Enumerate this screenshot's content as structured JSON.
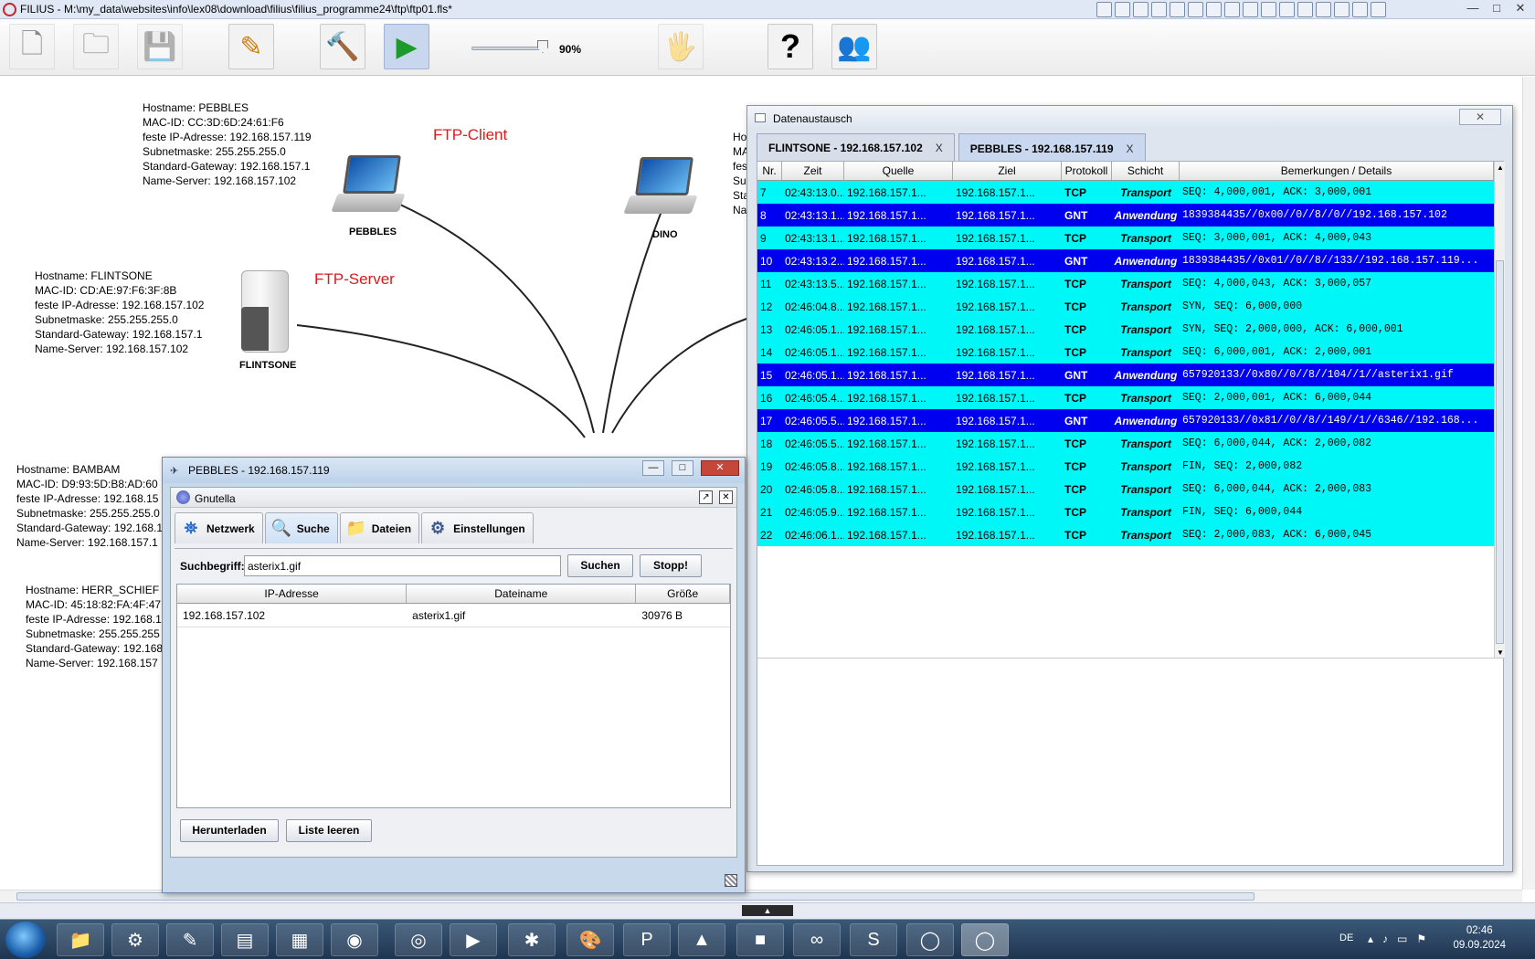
{
  "window": {
    "title": "FILIUS - M:\\my_data\\websites\\info\\lex08\\download\\filius\\filius_programme24\\ftp\\ftp01.fls*",
    "minimize": "—",
    "maximize": "□",
    "close": "✕"
  },
  "toolbar": {
    "zoom_label": "90%",
    "zoom_level": 0.9,
    "buttons": [
      {
        "icon": "new-file-icon",
        "glyph": "🗋"
      },
      {
        "icon": "open-folder-icon",
        "glyph": "🗀"
      },
      {
        "icon": "save-icon",
        "glyph": "💾"
      },
      {
        "icon": "pencil-icon",
        "glyph": "✎"
      },
      {
        "icon": "hammer-icon",
        "glyph": "🔨"
      },
      {
        "icon": "play-icon",
        "glyph": "▶"
      },
      {
        "icon": "documentation-icon",
        "glyph": "🖐"
      },
      {
        "icon": "help-icon",
        "glyph": "?"
      },
      {
        "icon": "info-icon",
        "glyph": "👥"
      }
    ]
  },
  "network": {
    "labels": {
      "ftp_client": "FTP-Client",
      "ftp_server": "FTP-Server"
    },
    "pebbles_info": [
      "Hostname: PEBBLES",
      "MAC-ID: CC:3D:6D:24:61:F6",
      "feste IP-Adresse: 192.168.157.119",
      "Subnetmaske: 255.255.255.0",
      "Standard-Gateway: 192.168.157.1",
      "Name-Server: 192.168.157.102"
    ],
    "flintsone_info": [
      "Hostname: FLINTSONE",
      "MAC-ID: CD:AE:97:F6:3F:8B",
      "feste IP-Adresse: 192.168.157.102",
      "Subnetmaske: 255.255.255.0",
      "Standard-Gateway: 192.168.157.1",
      "Name-Server: 192.168.157.102"
    ],
    "bambam_info": [
      "Hostname: BAMBAM",
      "MAC-ID: D9:93:5D:B8:AD:60",
      "feste IP-Adresse: 192.168.15",
      "Subnetmaske: 255.255.255.0",
      "Standard-Gateway: 192.168.1",
      "Name-Server: 192.168.157.1"
    ],
    "herr_info": [
      "Hostname: HERR_SCHIEF",
      "MAC-ID: 45:18:82:FA:4F:47",
      "feste IP-Adresse: 192.168.1",
      "Subnetmaske: 255.255.255",
      "Standard-Gateway: 192.168",
      "Name-Server: 192.168.157"
    ],
    "dino_partial": [
      "Ho",
      "MA",
      "fes",
      "Su",
      "Sta",
      "Na"
    ],
    "device_names": {
      "pebbles": "PEBBLES",
      "flintsone": "FLINTSONE",
      "dino": "DINO"
    }
  },
  "datenaustausch": {
    "title": "Datenaustausch",
    "tabs": [
      {
        "label": "FLINTSONE - 192.168.157.102",
        "close": "X"
      },
      {
        "label": "PEBBLES - 192.168.157.119",
        "close": "X"
      }
    ],
    "columns": [
      "Nr.",
      "Zeit",
      "Quelle",
      "Ziel",
      "Protokoll",
      "Schicht",
      "Bemerkungen / Details"
    ],
    "rows": [
      {
        "nr": "7",
        "zeit": "02:43:13.0...",
        "quelle": "192.168.157.1...",
        "ziel": "192.168.157.1...",
        "proto": "TCP",
        "schicht": "Transport",
        "det": "SEQ: 4,000,001, ACK: 3,000,001",
        "kind": "t"
      },
      {
        "nr": "8",
        "zeit": "02:43:13.1...",
        "quelle": "192.168.157.1...",
        "ziel": "192.168.157.1...",
        "proto": "GNT",
        "schicht": "Anwendung",
        "det": "1839384435//0x00//0//8//0//192.168.157.102",
        "kind": "a"
      },
      {
        "nr": "9",
        "zeit": "02:43:13.1...",
        "quelle": "192.168.157.1...",
        "ziel": "192.168.157.1...",
        "proto": "TCP",
        "schicht": "Transport",
        "det": "SEQ: 3,000,001, ACK: 4,000,043",
        "kind": "t"
      },
      {
        "nr": "10",
        "zeit": "02:43:13.2...",
        "quelle": "192.168.157.1...",
        "ziel": "192.168.157.1...",
        "proto": "GNT",
        "schicht": "Anwendung",
        "det": "1839384435//0x01//0//8//133//192.168.157.119...",
        "kind": "a"
      },
      {
        "nr": "11",
        "zeit": "02:43:13.5...",
        "quelle": "192.168.157.1...",
        "ziel": "192.168.157.1...",
        "proto": "TCP",
        "schicht": "Transport",
        "det": "SEQ: 4,000,043, ACK: 3,000,057",
        "kind": "t"
      },
      {
        "nr": "12",
        "zeit": "02:46:04.8...",
        "quelle": "192.168.157.1...",
        "ziel": "192.168.157.1...",
        "proto": "TCP",
        "schicht": "Transport",
        "det": "SYN, SEQ: 6,000,000",
        "kind": "t"
      },
      {
        "nr": "13",
        "zeit": "02:46:05.1...",
        "quelle": "192.168.157.1...",
        "ziel": "192.168.157.1...",
        "proto": "TCP",
        "schicht": "Transport",
        "det": "SYN, SEQ: 2,000,000, ACK: 6,000,001",
        "kind": "t"
      },
      {
        "nr": "14",
        "zeit": "02:46:05.1...",
        "quelle": "192.168.157.1...",
        "ziel": "192.168.157.1...",
        "proto": "TCP",
        "schicht": "Transport",
        "det": "SEQ: 6,000,001, ACK: 2,000,001",
        "kind": "t"
      },
      {
        "nr": "15",
        "zeit": "02:46:05.1...",
        "quelle": "192.168.157.1...",
        "ziel": "192.168.157.1...",
        "proto": "GNT",
        "schicht": "Anwendung",
        "det": "657920133//0x80//0//8//104//1//asterix1.gif",
        "kind": "a"
      },
      {
        "nr": "16",
        "zeit": "02:46:05.4...",
        "quelle": "192.168.157.1...",
        "ziel": "192.168.157.1...",
        "proto": "TCP",
        "schicht": "Transport",
        "det": "SEQ: 2,000,001, ACK: 6,000,044",
        "kind": "t"
      },
      {
        "nr": "17",
        "zeit": "02:46:05.5...",
        "quelle": "192.168.157.1...",
        "ziel": "192.168.157.1...",
        "proto": "GNT",
        "schicht": "Anwendung",
        "det": "657920133//0x81//0//8//149//1//6346//192.168...",
        "kind": "a"
      },
      {
        "nr": "18",
        "zeit": "02:46:05.5...",
        "quelle": "192.168.157.1...",
        "ziel": "192.168.157.1...",
        "proto": "TCP",
        "schicht": "Transport",
        "det": "SEQ: 6,000,044, ACK: 2,000,082",
        "kind": "t"
      },
      {
        "nr": "19",
        "zeit": "02:46:05.8...",
        "quelle": "192.168.157.1...",
        "ziel": "192.168.157.1...",
        "proto": "TCP",
        "schicht": "Transport",
        "det": "FIN, SEQ: 2,000,082",
        "kind": "t"
      },
      {
        "nr": "20",
        "zeit": "02:46:05.8...",
        "quelle": "192.168.157.1...",
        "ziel": "192.168.157.1...",
        "proto": "TCP",
        "schicht": "Transport",
        "det": "SEQ: 6,000,044, ACK: 2,000,083",
        "kind": "t"
      },
      {
        "nr": "21",
        "zeit": "02:46:05.9...",
        "quelle": "192.168.157.1...",
        "ziel": "192.168.157.1...",
        "proto": "TCP",
        "schicht": "Transport",
        "det": "FIN, SEQ: 6,000,044",
        "kind": "t"
      },
      {
        "nr": "22",
        "zeit": "02:46:06.1...",
        "quelle": "192.168.157.1...",
        "ziel": "192.168.157.1...",
        "proto": "TCP",
        "schicht": "Transport",
        "det": "SEQ: 2,000,083, ACK: 6,000,045",
        "kind": "t"
      }
    ]
  },
  "pebbles_window": {
    "title": "PEBBLES - 192.168.157.119",
    "app_title": "Gnutella",
    "tabs": [
      {
        "label": "Netzwerk",
        "icon": "network-icon",
        "glyph": "⛯"
      },
      {
        "label": "Suche",
        "icon": "magnifier-icon",
        "glyph": "🔍"
      },
      {
        "label": "Dateien",
        "icon": "folder-icon",
        "glyph": "📁"
      },
      {
        "label": "Einstellungen",
        "icon": "gears-icon",
        "glyph": "⚙"
      }
    ],
    "search_label": "Suchbegriff:",
    "search_value": "asterix1.gif",
    "search_button": "Suchen",
    "stop_button": "Stopp!",
    "result_columns": [
      "IP-Adresse",
      "Dateiname",
      "Größe"
    ],
    "results": [
      {
        "ip": "192.168.157.102",
        "file": "asterix1.gif",
        "size": "30976 B"
      }
    ],
    "download_button": "Herunterladen",
    "clear_button": "Liste leeren"
  },
  "taskbar": {
    "lang": "DE",
    "time": "02:46",
    "date": "09.09.2024",
    "apps": [
      "explorer",
      "filius",
      "notes",
      "table",
      "calculator",
      "globe",
      "chrome",
      "media",
      "puzzle",
      "paint",
      "powerpoint",
      "green",
      "red",
      "arduino",
      "s",
      "red-ring",
      "filius-active"
    ]
  }
}
